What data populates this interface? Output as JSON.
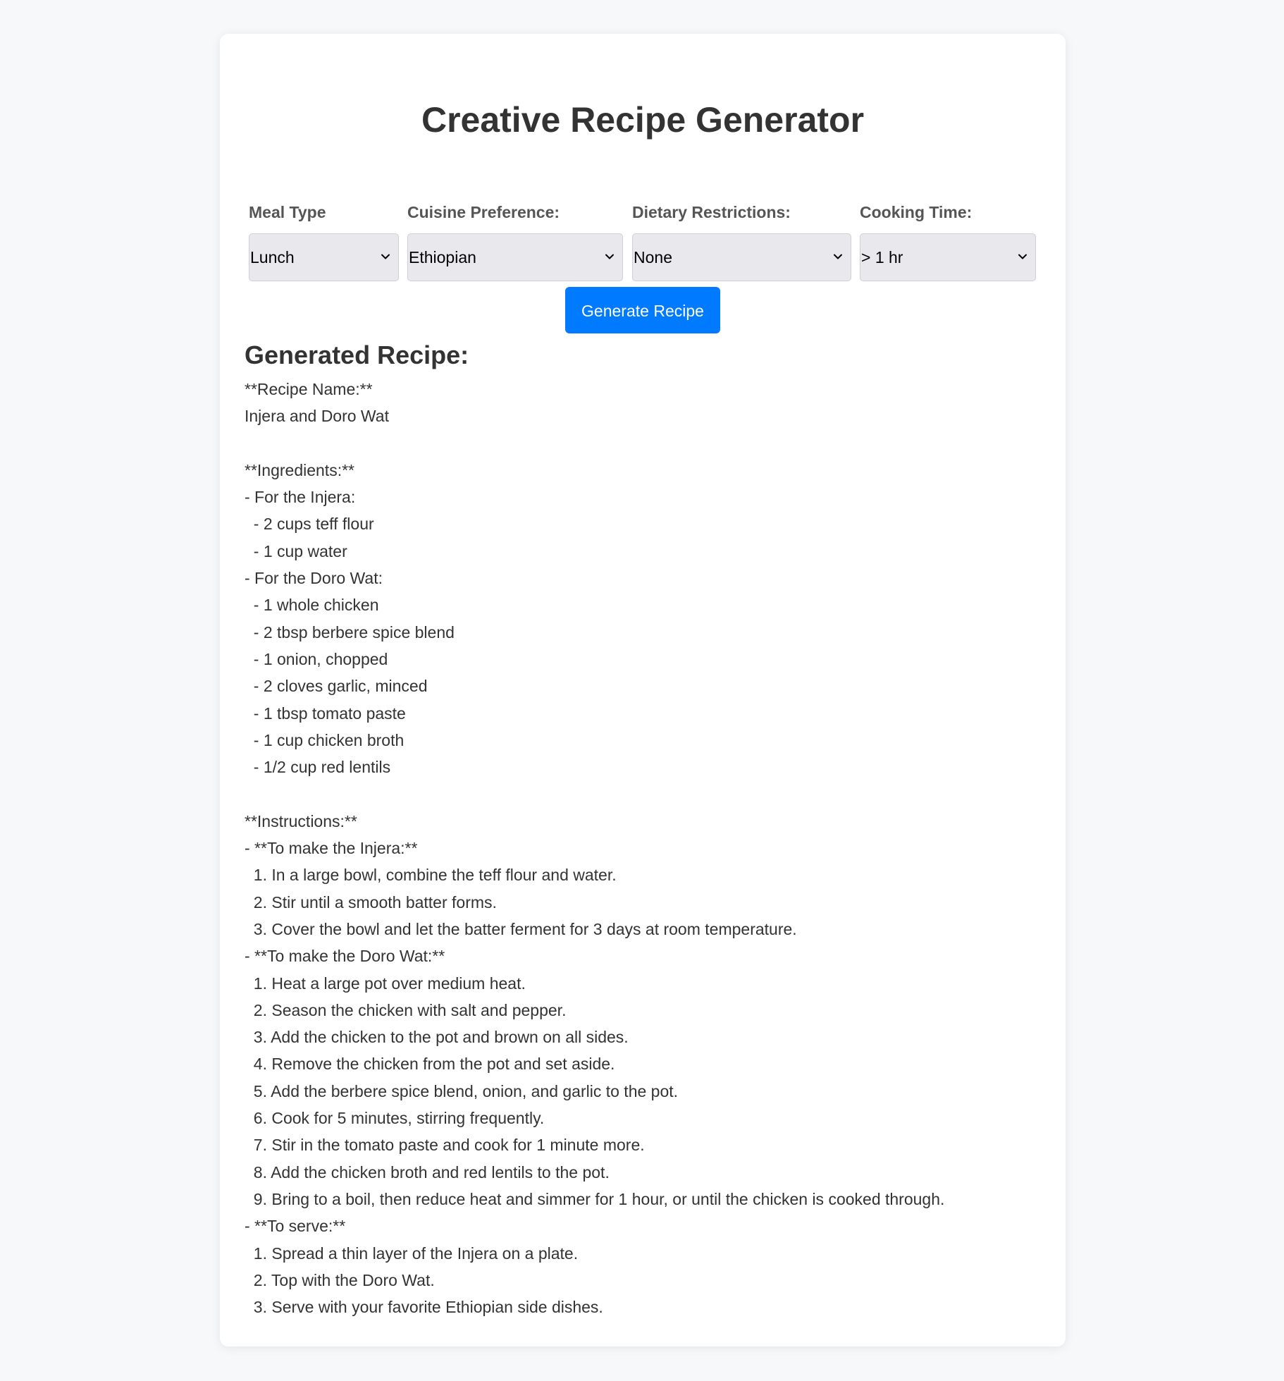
{
  "page": {
    "title": "Creative Recipe Generator"
  },
  "form": {
    "meal_type": {
      "label": "Meal Type",
      "value": "Lunch"
    },
    "cuisine": {
      "label": "Cuisine Preference:",
      "value": "Ethiopian"
    },
    "dietary": {
      "label": "Dietary Restrictions:",
      "value": "None"
    },
    "cooking_time": {
      "label": "Cooking Time:",
      "value": "> 1 hr"
    },
    "generate_label": "Generate Recipe"
  },
  "result": {
    "heading": "Generated Recipe:",
    "lines": [
      "**Recipe Name:**",
      "Injera and Doro Wat",
      "",
      "**Ingredients:**",
      "- For the Injera:",
      "  - 2 cups teff flour",
      "  - 1 cup water",
      "- For the Doro Wat:",
      "  - 1 whole chicken",
      "  - 2 tbsp berbere spice blend",
      "  - 1 onion, chopped",
      "  - 2 cloves garlic, minced",
      "  - 1 tbsp tomato paste",
      "  - 1 cup chicken broth",
      "  - 1/2 cup red lentils",
      "",
      "**Instructions:**",
      "- **To make the Injera:**",
      "  1. In a large bowl, combine the teff flour and water.",
      "  2. Stir until a smooth batter forms.",
      "  3. Cover the bowl and let the batter ferment for 3 days at room temperature.",
      "- **To make the Doro Wat:**",
      "  1. Heat a large pot over medium heat.",
      "  2. Season the chicken with salt and pepper.",
      "  3. Add the chicken to the pot and brown on all sides.",
      "  4. Remove the chicken from the pot and set aside.",
      "  5. Add the berbere spice blend, onion, and garlic to the pot.",
      "  6. Cook for 5 minutes, stirring frequently.",
      "  7. Stir in the tomato paste and cook for 1 minute more.",
      "  8. Add the chicken broth and red lentils to the pot.",
      "  9. Bring to a boil, then reduce heat and simmer for 1 hour, or until the chicken is cooked through.",
      "- **To serve:**",
      "  1. Spread a thin layer of the Injera on a plate.",
      "  2. Top with the Doro Wat.",
      "  3. Serve with your favorite Ethiopian side dishes."
    ]
  },
  "colors": {
    "page_background": "#f7f8fa",
    "card_background": "#ffffff",
    "accent": "#007bff",
    "select_background": "#e9e9ed",
    "text": "#333333",
    "label_text": "#555555"
  },
  "icons": {
    "select_arrow": "chevron-down-icon"
  }
}
